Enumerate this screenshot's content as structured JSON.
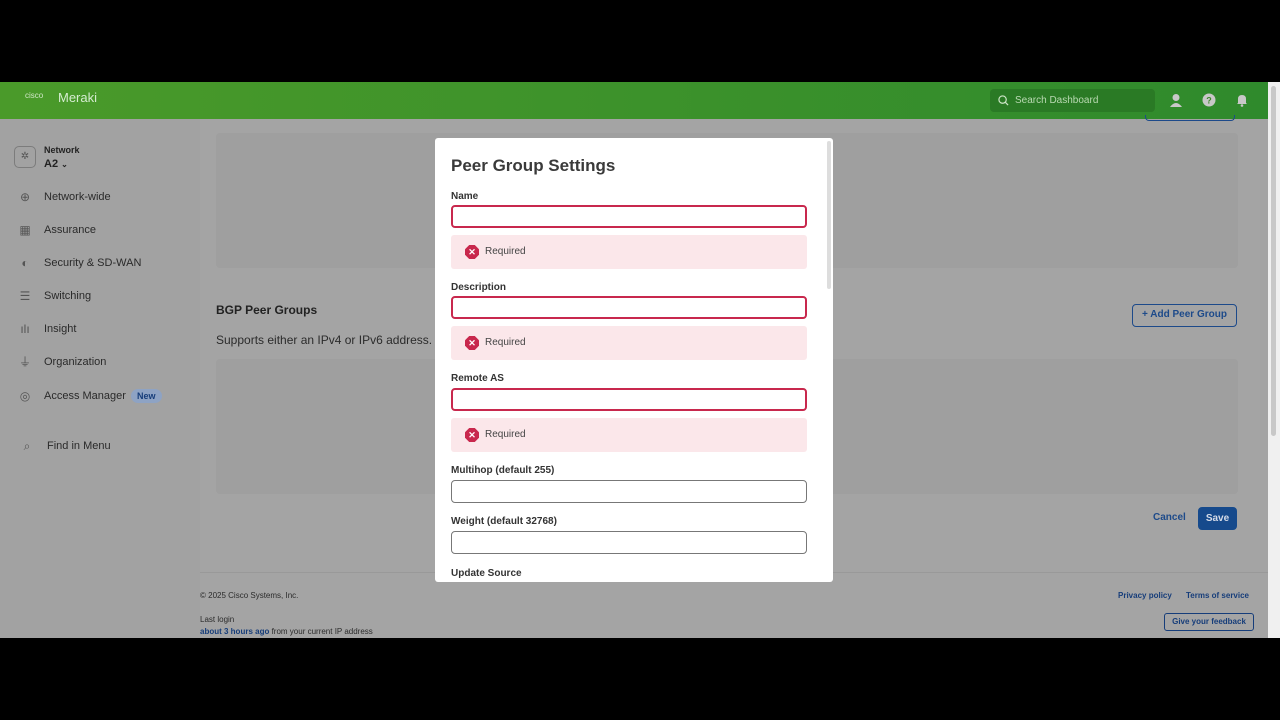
{
  "header": {
    "brand_small": "cisco",
    "brand": "Meraki",
    "search_placeholder": "Search Dashboard"
  },
  "sidebar": {
    "network_label": "Network",
    "network_value": "A2",
    "items": [
      {
        "label": "Network-wide",
        "icon": "globe-icon"
      },
      {
        "label": "Assurance",
        "icon": "assurance-icon"
      },
      {
        "label": "Security & SD-WAN",
        "icon": "shield-icon"
      },
      {
        "label": "Switching",
        "icon": "switch-icon"
      },
      {
        "label": "Insight",
        "icon": "bar-chart-icon"
      },
      {
        "label": "Organization",
        "icon": "organization-icon"
      },
      {
        "label": "Access Manager",
        "icon": "fingerprint-icon",
        "badge": "New"
      }
    ],
    "find": "Find in Menu"
  },
  "main": {
    "bgp_title": "BGP Peer Groups",
    "bgp_sub": "Supports either an IPv4 or IPv6 address.",
    "add_peer_group": "Add Peer Group",
    "cancel": "Cancel",
    "save": "Save"
  },
  "footer": {
    "copyright": "© 2025 Cisco Systems, Inc.",
    "last_login": "Last login",
    "last_login_time": "about 3 hours ago",
    "last_login_suffix": " from your current IP address",
    "privacy": "Privacy policy",
    "terms": "Terms of service",
    "feedback": "Give your feedback"
  },
  "modal": {
    "title": "Peer Group Settings",
    "fields": [
      {
        "label": "Name",
        "value": "",
        "error": "Required"
      },
      {
        "label": "Description",
        "value": "",
        "error": "Required"
      },
      {
        "label": "Remote AS",
        "value": "",
        "error": "Required"
      },
      {
        "label": "Multihop (default 255)",
        "value": ""
      },
      {
        "label": "Weight (default 32768)",
        "value": ""
      },
      {
        "label": "Update Source"
      }
    ]
  },
  "colors": {
    "header_green": "#3f922b",
    "error": "#c8284d",
    "link_blue": "#1d4a8a"
  }
}
